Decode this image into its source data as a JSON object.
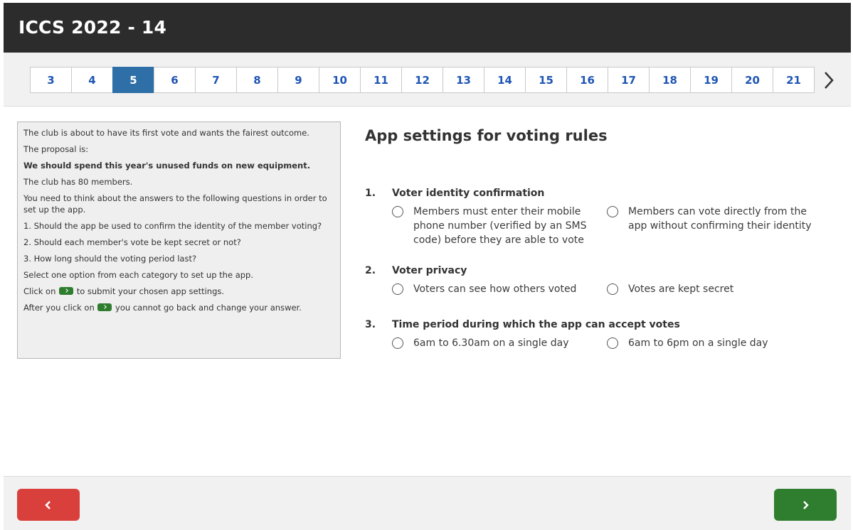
{
  "app": {
    "title": "ICCS 2022 - 14"
  },
  "pagination": {
    "pages": [
      "3",
      "4",
      "5",
      "6",
      "7",
      "8",
      "9",
      "10",
      "11",
      "12",
      "13",
      "14",
      "15",
      "16",
      "17",
      "18",
      "19",
      "20",
      "21"
    ],
    "active": "5"
  },
  "instructions": {
    "line1": "The club is about to have its first vote and wants the fairest outcome.",
    "line2": "The proposal is:",
    "proposal": "We should spend this year's unused funds on new equipment.",
    "line3": "The club has 80 members.",
    "line4": "You need to think about the answers to the following questions in order to set up the app.",
    "q1": "1. Should the app be used to confirm the identity of the member voting?",
    "q2": "2. Should each member's vote be kept secret or not?",
    "q3": "3. How long should the voting period last?",
    "line5": "Select one option from each category to set up the app.",
    "click_pre": "Click on",
    "click_post": "to submit your chosen app settings.",
    "after_pre": "After you click on",
    "after_post": "you cannot go back and change your answer."
  },
  "main": {
    "heading": "App settings for voting rules",
    "questions": [
      {
        "num": "1.",
        "title": "Voter identity confirmation",
        "options": [
          "Members must enter their mobile phone number (verified by an SMS code) before they are able to vote",
          "Members can vote directly from the app without confirming their identity"
        ]
      },
      {
        "num": "2.",
        "title": "Voter privacy",
        "options": [
          "Voters can see how others voted",
          "Votes are kept secret"
        ]
      },
      {
        "num": "3.",
        "title": "Time period during which the app can accept votes",
        "options": [
          "6am to 6.30am on a single day",
          "6am to 6pm on a single day"
        ]
      }
    ]
  },
  "colors": {
    "header_bg": "#2c2c2c",
    "active_page": "#2e6fa7",
    "page_text": "#1f55b5",
    "back_button": "#d9403c",
    "next_button": "#2f7d2f"
  },
  "icons": {
    "next_page": "chevron-right-icon",
    "back": "chevron-left-icon",
    "next": "chevron-right-icon"
  }
}
